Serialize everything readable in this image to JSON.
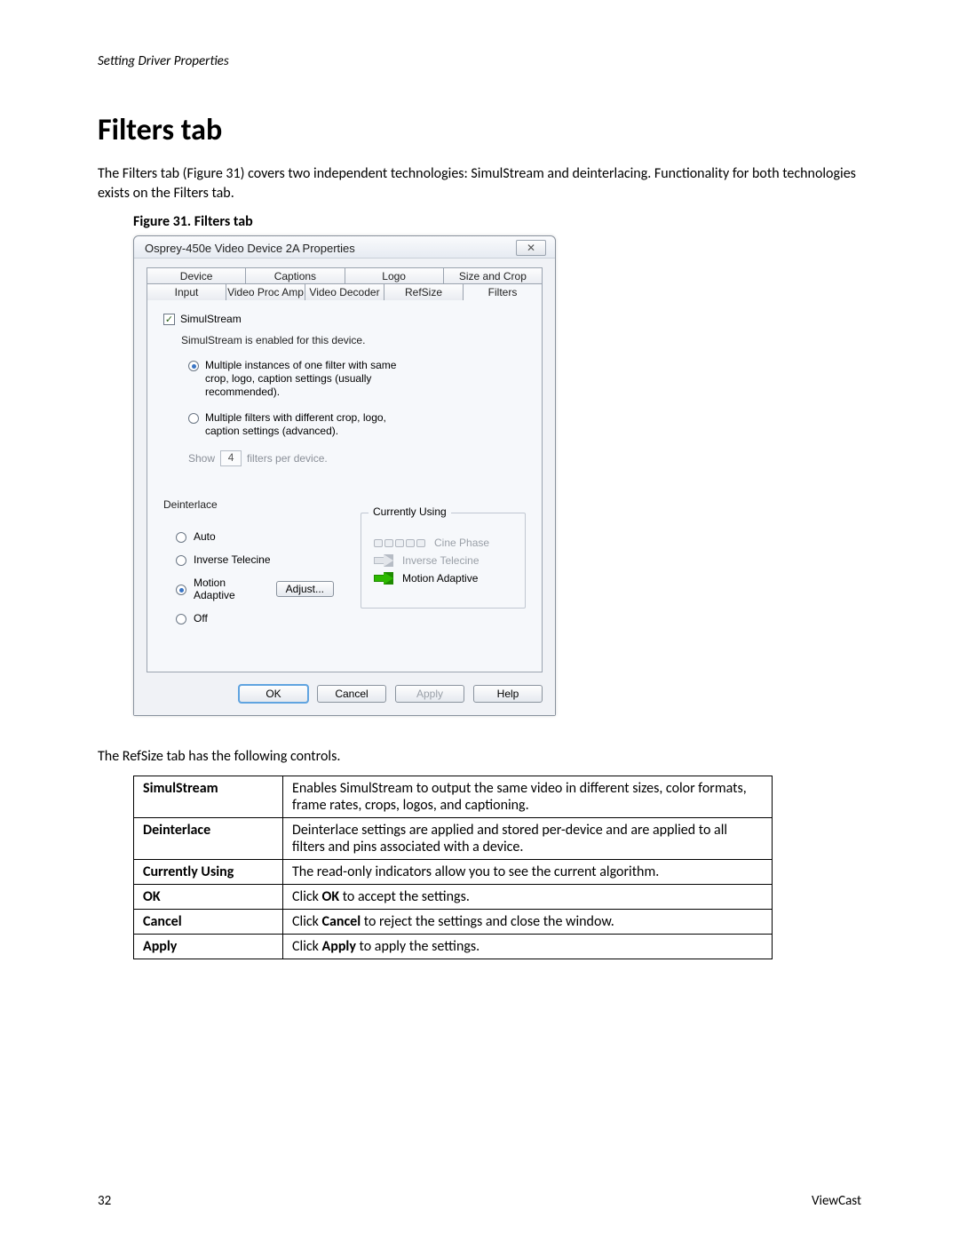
{
  "header": {
    "section": "Setting Driver Properties"
  },
  "title": "Filters tab",
  "intro": "The Filters tab (Figure 31) covers two independent technologies: SimulStream and deinterlacing. Functionality for both technologies exists on the Filters tab.",
  "figure_caption": "Figure 31. Filters tab",
  "below_text": "The RefSize tab has the following controls.",
  "footer": {
    "page": "32",
    "brand": "ViewCast"
  },
  "dialog": {
    "title": "Osprey-450e Video Device 2A Properties",
    "tabs_row1": [
      "Device",
      "Captions",
      "Logo",
      "Size and Crop"
    ],
    "tabs_row2": [
      "Input",
      "Video Proc Amp",
      "Video Decoder",
      "RefSize",
      "Filters"
    ],
    "active_tab": "Filters",
    "simulstream": {
      "checkbox_label": "SimulStream",
      "checked": true,
      "enabled_text": "SimulStream is enabled for this device.",
      "radio1": "Multiple instances of one filter with same crop, logo, caption settings (usually recommended).",
      "radio2": "Multiple filters with different crop, logo, caption settings (advanced).",
      "selected": 1,
      "show_prefix": "Show",
      "show_value": "4",
      "show_suffix": "filters per device."
    },
    "deinterlace": {
      "group_label": "Deinterlace",
      "options": [
        "Auto",
        "Inverse Telecine",
        "Motion Adaptive",
        "Off"
      ],
      "selected": "Motion Adaptive",
      "adjust_label": "Adjust..."
    },
    "currently_using": {
      "legend": "Currently Using",
      "rows": [
        {
          "label": "Cine Phase",
          "state": "dim"
        },
        {
          "label": "Inverse Telecine",
          "state": "blank"
        },
        {
          "label": "Motion Adaptive",
          "state": "green"
        }
      ]
    },
    "buttons": {
      "ok": "OK",
      "cancel": "Cancel",
      "apply": "Apply",
      "help": "Help"
    }
  },
  "controls_table": [
    {
      "key": "SimulStream",
      "val": "Enables SimulStream to output the same video in different sizes, color formats, frame rates, crops, logos, and captioning."
    },
    {
      "key": "Deinterlace",
      "val": "Deinterlace settings are applied and stored per-device and are applied to all filters and pins associated with a device."
    },
    {
      "key": "Currently Using",
      "val": "The read-only indicators allow you to see the current algorithm."
    },
    {
      "key": "OK",
      "val_pre": "Click ",
      "val_bold": "OK",
      "val_post": " to accept the settings."
    },
    {
      "key": "Cancel",
      "val_pre": "Click ",
      "val_bold": "Cancel",
      "val_post": " to reject the settings and close the window."
    },
    {
      "key": "Apply",
      "val_pre": "Click ",
      "val_bold": "Apply",
      "val_post": " to apply the settings."
    }
  ]
}
